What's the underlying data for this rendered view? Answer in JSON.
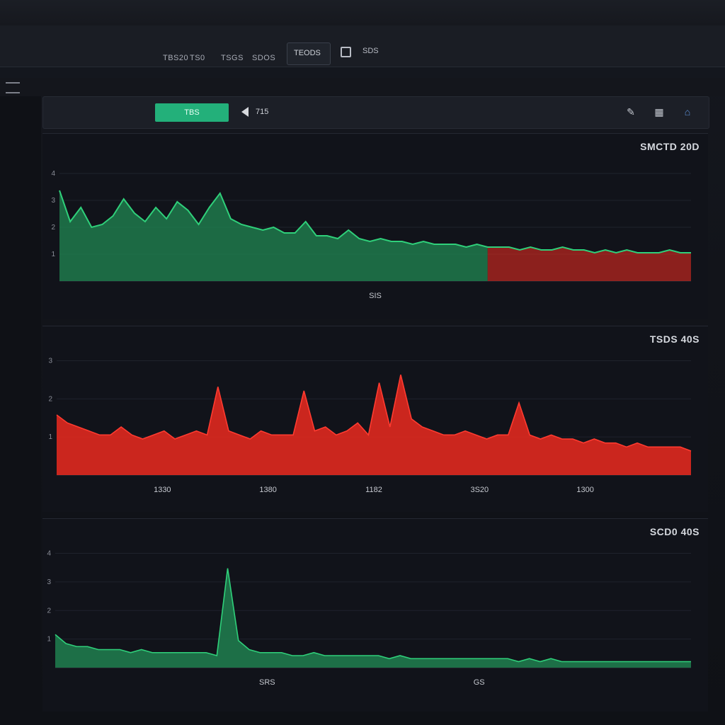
{
  "top_menu": {
    "items": [
      "TBS20",
      "TS0",
      "TSGS",
      "SDOS",
      "TEODS"
    ],
    "active_tab": "TEODS",
    "box_tab_label": "SDS"
  },
  "toolbar": {
    "action_button_label": "TBS",
    "page_value": "715",
    "icons": [
      "wrench-icon",
      "grid-icon",
      "user-icon"
    ]
  },
  "panels": [
    {
      "readout": "SMCTD 20D",
      "ytick_labels": [
        "1",
        "2",
        "3",
        "4"
      ],
      "xtick_labels": [
        "SIS"
      ],
      "x_end_label": ""
    },
    {
      "readout": "TSDS 40S",
      "ytick_labels": [
        "1",
        "2",
        "3"
      ],
      "xtick_labels": [
        "1330",
        "1380",
        "1182",
        "3S20",
        "1300"
      ],
      "x_end_label": ""
    },
    {
      "readout": "SCD0 40S",
      "ytick_labels": [
        "1",
        "2",
        "3",
        "4"
      ],
      "xtick_labels": [
        "SRS",
        "GS"
      ],
      "x_end_label": ""
    }
  ],
  "colors": {
    "green": "#2fd07a",
    "green_fill": "#1f7a4c",
    "red": "#ff3b30",
    "red_fill": "#e0291f",
    "accent_button": "#23b07a",
    "background": "#11131a"
  },
  "chart_data": [
    {
      "type": "area",
      "series": [
        {
          "values": [
            3.2,
            2.1,
            2.6,
            1.9,
            2.0,
            2.3,
            2.9,
            2.4,
            2.1,
            2.6,
            2.2,
            2.8,
            2.5,
            2.0,
            2.6,
            3.1,
            2.2,
            2.0,
            1.9,
            1.8,
            1.9,
            1.7,
            1.7,
            2.1,
            1.6,
            1.6,
            1.5,
            1.8,
            1.5,
            1.4,
            1.5,
            1.4,
            1.4,
            1.3,
            1.4,
            1.3,
            1.3,
            1.3,
            1.2,
            1.3,
            1.2,
            1.2,
            1.2,
            1.1,
            1.2,
            1.1,
            1.1,
            1.2,
            1.1,
            1.1,
            1.0,
            1.1,
            1.0,
            1.1,
            1.0,
            1.0,
            1.0,
            1.1,
            1.0,
            1.0
          ]
        }
      ],
      "ylim": [
        0,
        4
      ]
    },
    {
      "type": "area",
      "series": [
        {
          "values": [
            1.5,
            1.3,
            1.2,
            1.1,
            1.0,
            1.0,
            1.2,
            1.0,
            0.9,
            1.0,
            1.1,
            0.9,
            1.0,
            1.1,
            1.0,
            2.2,
            1.1,
            1.0,
            0.9,
            1.1,
            1.0,
            1.0,
            1.0,
            2.1,
            1.1,
            1.2,
            1.0,
            1.1,
            1.3,
            1.0,
            2.3,
            1.2,
            2.5,
            1.4,
            1.2,
            1.1,
            1.0,
            1.0,
            1.1,
            1.0,
            0.9,
            1.0,
            1.0,
            1.8,
            1.0,
            0.9,
            1.0,
            0.9,
            0.9,
            0.8,
            0.9,
            0.8,
            0.8,
            0.7,
            0.8,
            0.7,
            0.7,
            0.7,
            0.7,
            0.6
          ]
        }
      ],
      "ylim": [
        0,
        3
      ]
    },
    {
      "type": "area",
      "series": [
        {
          "values": [
            1.1,
            0.8,
            0.7,
            0.7,
            0.6,
            0.6,
            0.6,
            0.5,
            0.6,
            0.5,
            0.5,
            0.5,
            0.5,
            0.5,
            0.5,
            0.4,
            3.3,
            0.9,
            0.6,
            0.5,
            0.5,
            0.5,
            0.4,
            0.4,
            0.5,
            0.4,
            0.4,
            0.4,
            0.4,
            0.4,
            0.4,
            0.3,
            0.4,
            0.3,
            0.3,
            0.3,
            0.3,
            0.3,
            0.3,
            0.3,
            0.3,
            0.3,
            0.3,
            0.2,
            0.3,
            0.2,
            0.3,
            0.2,
            0.2,
            0.2,
            0.2,
            0.2,
            0.2,
            0.2,
            0.2,
            0.2,
            0.2,
            0.2,
            0.2,
            0.2
          ]
        }
      ],
      "ylim": [
        0,
        4
      ]
    }
  ]
}
